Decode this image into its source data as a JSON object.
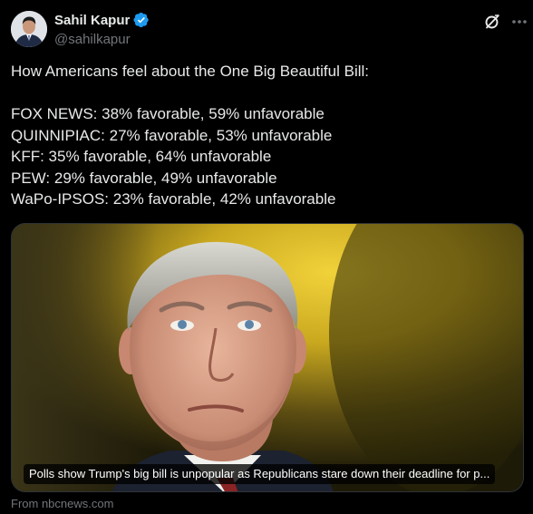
{
  "author": {
    "display_name": "Sahil Kapur",
    "handle": "@sahilkapur",
    "verified": true,
    "avatar_icon": "profile-photo",
    "verified_icon": "verified-badge-icon"
  },
  "header_icons": {
    "grok": "grok-icon",
    "more": "more-options-icon"
  },
  "tweet": {
    "intro": "How Americans feel about the One Big Beautiful Bill:",
    "polls": [
      "FOX NEWS: 38% favorable, 59% unfavorable",
      "QUINNIPIAC: 27% favorable, 53% unfavorable",
      "KFF: 35% favorable, 64% unfavorable",
      "PEW: 29% favorable, 49% unfavorable",
      "WaPo-IPSOS: 23% favorable, 42% unfavorable"
    ]
  },
  "link_card": {
    "headline": "Polls show Trump's big bill is unpopular as Republicans stare down their deadline for p...",
    "source": "From nbcnews.com"
  },
  "colors": {
    "background": "#000000",
    "text_primary": "#e7e9ea",
    "text_secondary": "#71767b",
    "verified_blue": "#1d9bf0",
    "border": "#2f3336"
  }
}
